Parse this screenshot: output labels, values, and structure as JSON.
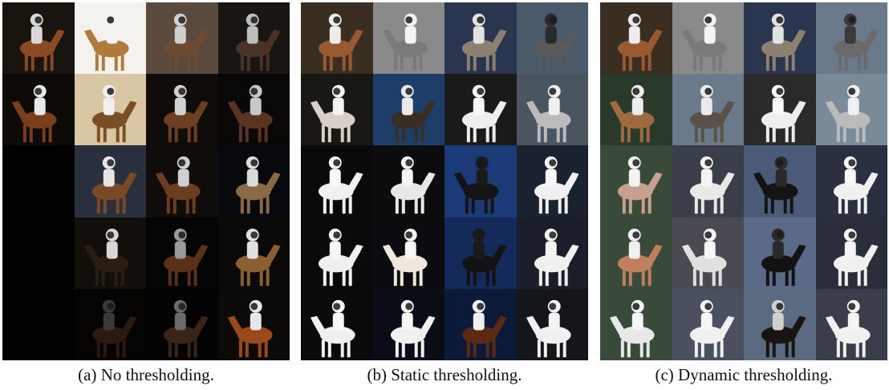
{
  "captions": {
    "a": "(a) No thresholding.",
    "b": "(b) Static thresholding.",
    "c": "(c) Dynamic thresholding."
  },
  "panels": {
    "a": {
      "cells": [
        {
          "bg": "#1a140f",
          "horse": "#8a4a22",
          "suit": "#d8d8d8"
        },
        {
          "bg": "#f4f2ef",
          "horse": "#b07a3a",
          "suit": "#f2f2f2"
        },
        {
          "bg": "#5a4a3e",
          "horse": "#6e4a30",
          "suit": "#cfcfcf"
        },
        {
          "bg": "#191512",
          "horse": "#4a3326",
          "suit": "#bdbdbd"
        },
        {
          "bg": "#0d0a08",
          "horse": "#7a3e1c",
          "suit": "#e8e8e8"
        },
        {
          "bg": "#d9c7a4",
          "horse": "#7a4f24",
          "suit": "#f0f0f0"
        },
        {
          "bg": "#0f0c0a",
          "horse": "#6d3f22",
          "suit": "#d0d0d0"
        },
        {
          "bg": "#0a0807",
          "horse": "#5a3420",
          "suit": "#c8c8c8"
        },
        {
          "bg": "#000000",
          "horse": "#000000",
          "suit": "#000000"
        },
        {
          "bg": "#2a2f3e",
          "horse": "#7a4a26",
          "suit": "#e6e6e6"
        },
        {
          "bg": "#0f0c0a",
          "horse": "#6a3e1e",
          "suit": "#cfcfcf"
        },
        {
          "bg": "#07090c",
          "horse": "#8a6a45",
          "suit": "#dcdcdc"
        },
        {
          "bg": "#000000",
          "horse": "#000000",
          "suit": "#000000"
        },
        {
          "bg": "#120f0a",
          "horse": "#2a1d14",
          "suit": "#d6d6d6"
        },
        {
          "bg": "#050404",
          "horse": "#5a3018",
          "suit": "#9a9a9a"
        },
        {
          "bg": "#0a0908",
          "horse": "#8a6030",
          "suit": "#e0e0e0"
        },
        {
          "bg": "#000000",
          "horse": "#000000",
          "suit": "#000000"
        },
        {
          "bg": "#050403",
          "horse": "#2a1a10",
          "suit": "#3a3a3a"
        },
        {
          "bg": "#040303",
          "horse": "#3a2416",
          "suit": "#6a6a6a"
        },
        {
          "bg": "#0c0a08",
          "horse": "#9a4a18",
          "suit": "#e8e8e8"
        }
      ]
    },
    "b": {
      "cells": [
        {
          "bg": "#3a2e22",
          "horse": "#9a5a30",
          "suit": "#ececec"
        },
        {
          "bg": "#8a8a8a",
          "horse": "#7a7a7a",
          "suit": "#f4f4f4"
        },
        {
          "bg": "#2a3550",
          "horse": "#8c8070",
          "suit": "#e2e2e2"
        },
        {
          "bg": "#4a5a6a",
          "horse": "#5a5a5a",
          "suit": "#2a2a2a"
        },
        {
          "bg": "#1a1814",
          "horse": "#d8d0c8",
          "suit": "#f4f4f4"
        },
        {
          "bg": "#1e3e6a",
          "horse": "#3a2e24",
          "suit": "#eaeaea"
        },
        {
          "bg": "#1a1a1a",
          "horse": "#eeeeee",
          "suit": "#f8f8f8"
        },
        {
          "bg": "#4a5560",
          "horse": "#bbbbbb",
          "suit": "#f0f0f0"
        },
        {
          "bg": "#0a0a0a",
          "horse": "#f0f0f0",
          "suit": "#f8f8f8"
        },
        {
          "bg": "#0c0c0c",
          "horse": "#e8e8e8",
          "suit": "#f4f4f4"
        },
        {
          "bg": "#1a3a78",
          "horse": "#141414",
          "suit": "#1a1a1a"
        },
        {
          "bg": "#1a2230",
          "horse": "#f0f0f0",
          "suit": "#f6f6f6"
        },
        {
          "bg": "#0a0a0a",
          "horse": "#f0f0f0",
          "suit": "#f6f6f6"
        },
        {
          "bg": "#0c0c10",
          "horse": "#efe8dc",
          "suit": "#f6f6f6"
        },
        {
          "bg": "#142a5a",
          "horse": "#121212",
          "suit": "#1a1a1a"
        },
        {
          "bg": "#1a1e28",
          "horse": "#f0f0f0",
          "suit": "#f4f4f4"
        },
        {
          "bg": "#0a0a0a",
          "horse": "#f0f0f0",
          "suit": "#f8f8f8"
        },
        {
          "bg": "#0a0c16",
          "horse": "#f0f0f0",
          "suit": "#f6f6f6"
        },
        {
          "bg": "#0c1a3a",
          "horse": "#5a2a12",
          "suit": "#f0f0f0"
        },
        {
          "bg": "#14161c",
          "horse": "#f0f0f0",
          "suit": "#f4f4f4"
        }
      ]
    },
    "c": {
      "cells": [
        {
          "bg": "#3a2e22",
          "horse": "#9a5a30",
          "suit": "#ececec"
        },
        {
          "bg": "#8a8a8a",
          "horse": "#7a7a7a",
          "suit": "#f4f4f4"
        },
        {
          "bg": "#2a3550",
          "horse": "#8c8070",
          "suit": "#e2e2e2"
        },
        {
          "bg": "#6a7a8a",
          "horse": "#6a6a6a",
          "suit": "#3a3a3a"
        },
        {
          "bg": "#2a3a2a",
          "horse": "#a06a40",
          "suit": "#eeeeee"
        },
        {
          "bg": "#6a7a8a",
          "horse": "#5a5248",
          "suit": "#eaeaea"
        },
        {
          "bg": "#2a2a2a",
          "horse": "#eeeeee",
          "suit": "#f8f8f8"
        },
        {
          "bg": "#7a8a98",
          "horse": "#bbbbbb",
          "suit": "#f0f0f0"
        },
        {
          "bg": "#3a4a3a",
          "horse": "#c8a090",
          "suit": "#f2f2f2"
        },
        {
          "bg": "#3a3e48",
          "horse": "#e8e8e8",
          "suit": "#f4f4f4"
        },
        {
          "bg": "#4a5a78",
          "horse": "#141414",
          "suit": "#2a2a2a"
        },
        {
          "bg": "#2a3040",
          "horse": "#f0f0f0",
          "suit": "#f6f6f6"
        },
        {
          "bg": "#3a4a3a",
          "horse": "#c08060",
          "suit": "#f0f0f0"
        },
        {
          "bg": "#4a4a52",
          "horse": "#e0e0e0",
          "suit": "#f6f6f6"
        },
        {
          "bg": "#5a6a88",
          "horse": "#121212",
          "suit": "#2a2a2a"
        },
        {
          "bg": "#2a2e3a",
          "horse": "#f0f0f0",
          "suit": "#f4f4f4"
        },
        {
          "bg": "#3a4a3a",
          "horse": "#e8e8e8",
          "suit": "#f6f6f6"
        },
        {
          "bg": "#4a5060",
          "horse": "#f0f0f0",
          "suit": "#f6f6f6"
        },
        {
          "bg": "#5a6a80",
          "horse": "#1a1410",
          "suit": "#d0d0d0"
        },
        {
          "bg": "#3a3e4a",
          "horse": "#f0f0f0",
          "suit": "#f4f4f4"
        }
      ]
    }
  }
}
